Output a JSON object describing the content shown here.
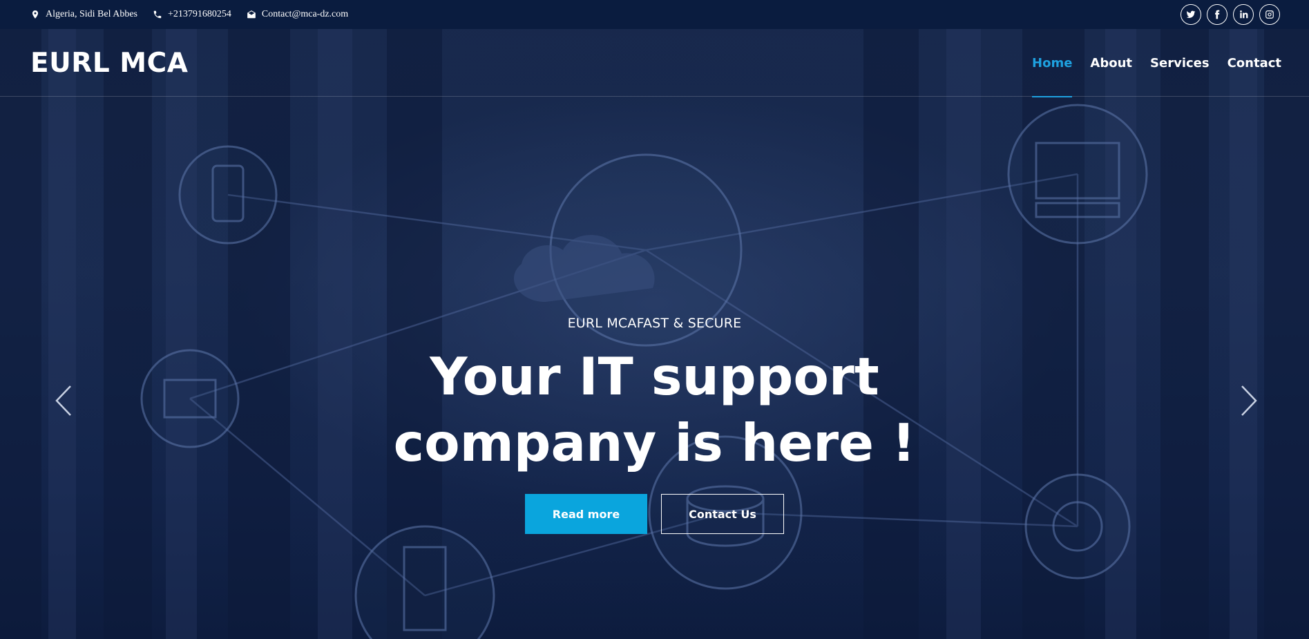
{
  "topbar": {
    "location": "Algeria, Sidi Bel Abbes",
    "phone": "+213791680254",
    "email": "Contact@mca-dz.com",
    "socials": [
      {
        "name": "twitter-icon"
      },
      {
        "name": "facebook-icon"
      },
      {
        "name": "linkedin-icon"
      },
      {
        "name": "instagram-icon"
      }
    ]
  },
  "header": {
    "logo": "EURL MCA",
    "nav": [
      {
        "label": "Home",
        "active": true
      },
      {
        "label": "About",
        "active": false
      },
      {
        "label": "Services",
        "active": false
      },
      {
        "label": "Contact",
        "active": false
      }
    ]
  },
  "hero": {
    "eyebrow": "EURL MCAFAST & SECURE",
    "headline_line1": "Your IT support",
    "headline_line2": "company is here !",
    "primary_button": "Read more",
    "secondary_button": "Contact Us"
  },
  "colors": {
    "accent": "#1ea1e0",
    "button": "#0aa5dd",
    "topbar": "#0a1c3f",
    "background": "#162850"
  }
}
